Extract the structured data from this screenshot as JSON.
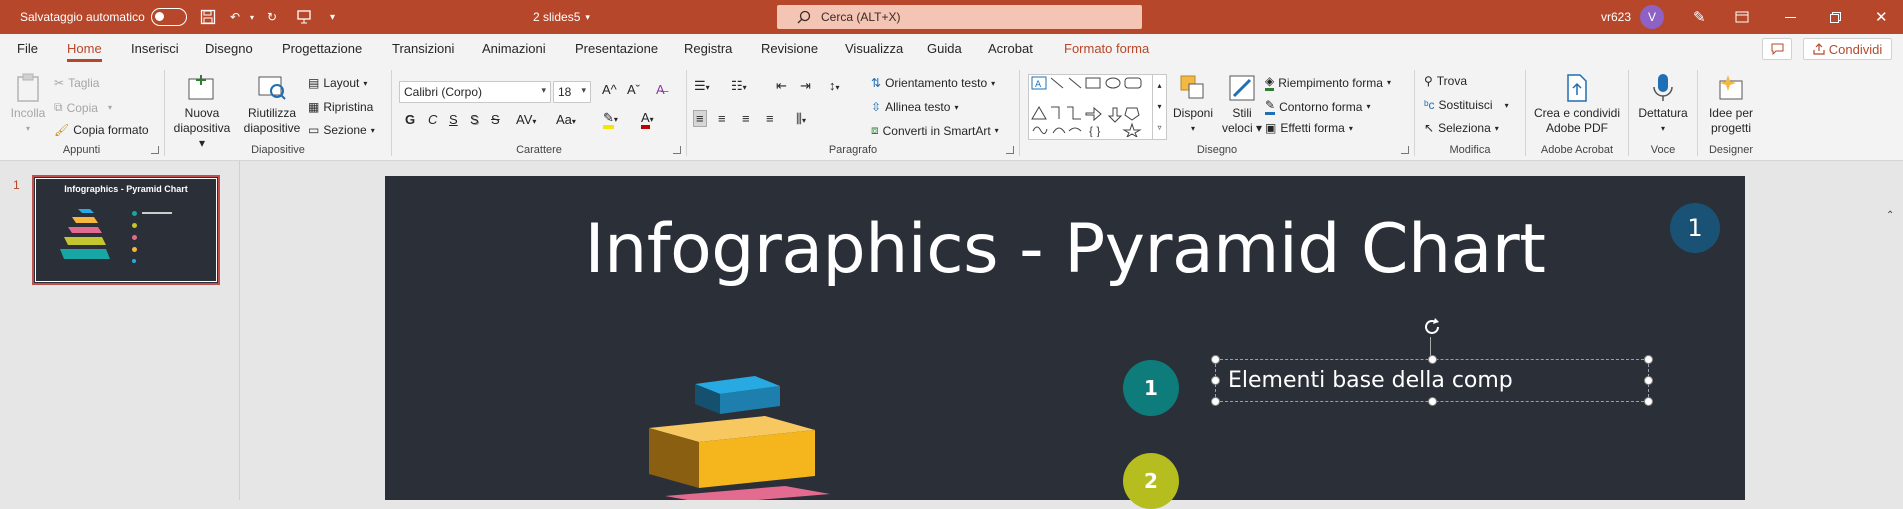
{
  "titlebar": {
    "autosave_label": "Salvataggio automatico",
    "filename": "2 slides5",
    "search_placeholder": "Cerca (ALT+X)",
    "username": "vr623",
    "avatar_initial": "V"
  },
  "menubar": {
    "tabs": [
      "File",
      "Home",
      "Inserisci",
      "Disegno",
      "Progettazione",
      "Transizioni",
      "Animazioni",
      "Presentazione",
      "Registra",
      "Revisione",
      "Visualizza",
      "Guida",
      "Acrobat",
      "Formato forma"
    ],
    "share_label": "Condividi"
  },
  "ribbon": {
    "appunti": {
      "label": "Appunti",
      "incolla": "Incolla",
      "taglia": "Taglia",
      "copia": "Copia",
      "copia_formato": "Copia formato"
    },
    "diapositive": {
      "label": "Diapositive",
      "nuova_l1": "Nuova",
      "nuova_l2": "diapositiva",
      "riutilizza_l1": "Riutilizza",
      "riutilizza_l2": "diapositive",
      "layout": "Layout",
      "ripristina": "Ripristina",
      "sezione": "Sezione"
    },
    "carattere": {
      "label": "Carattere",
      "font": "Calibri (Corpo)",
      "size": "18",
      "grow": "A^",
      "shrink": "Aˇ",
      "bold": "G",
      "italic": "C",
      "underline": "S",
      "strike": "S",
      "spacing": "AV",
      "case": "Aa",
      "font_color": "A"
    },
    "paragrafo": {
      "label": "Paragrafo",
      "orientamento": "Orientamento testo",
      "allinea": "Allinea testo",
      "converti": "Converti in SmartArt"
    },
    "disegno": {
      "label": "Disegno",
      "disponi": "Disponi",
      "stili_l1": "Stili",
      "stili_l2": "veloci",
      "riempimento": "Riempimento forma",
      "contorno": "Contorno forma",
      "effetti": "Effetti forma"
    },
    "modifica": {
      "label": "Modifica",
      "trova": "Trova",
      "sostituisci": "Sostituisci",
      "seleziona": "Seleziona"
    },
    "acrobat": {
      "label": "Adobe Acrobat",
      "crea_l1": "Crea e condividi",
      "crea_l2": "Adobe PDF"
    },
    "voce": {
      "label": "Voce",
      "dettatura": "Dettatura"
    },
    "designer": {
      "label": "Designer",
      "idee_l1": "Idee per",
      "idee_l2": "progetti"
    }
  },
  "thumbnails": {
    "number": "1",
    "title": "Infographics - Pyramid Chart"
  },
  "slide": {
    "title": "Infographics - Pyramid Chart",
    "badge": "1",
    "items": [
      {
        "number": "1",
        "text": "Elementi base della comp",
        "color": "#0e7c7b"
      },
      {
        "number": "2",
        "text": "",
        "color": "#b5bd1f"
      }
    ]
  },
  "colors": {
    "accent": "#b7472a",
    "slide_bg": "#2b2f38",
    "badge": "#1a5276"
  }
}
